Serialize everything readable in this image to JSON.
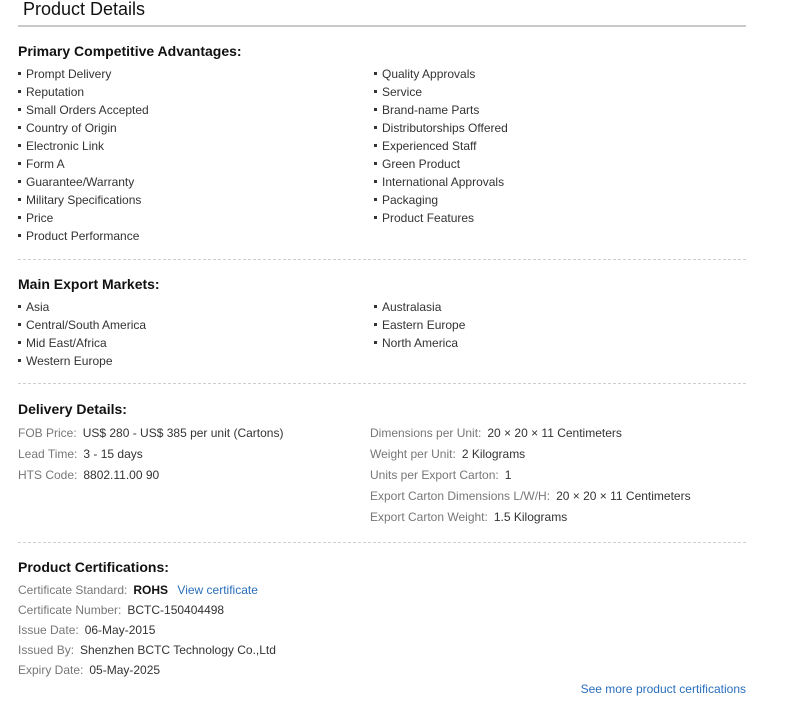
{
  "page": {
    "title": "Product Details"
  },
  "advantages": {
    "heading": "Primary Competitive Advantages:",
    "left": [
      "Prompt Delivery",
      "Reputation",
      "Small Orders Accepted",
      "Country of Origin",
      "Electronic Link",
      "Form A",
      "Guarantee/Warranty",
      "Military Specifications",
      "Price",
      "Product Performance"
    ],
    "right": [
      "Quality Approvals",
      "Service",
      "Brand-name Parts",
      "Distributorships Offered",
      "Experienced Staff",
      "Green Product",
      "International Approvals",
      "Packaging",
      "Product Features"
    ]
  },
  "markets": {
    "heading": "Main Export Markets:",
    "left": [
      "Asia",
      "Central/South America",
      "Mid East/Africa",
      "Western Europe"
    ],
    "right": [
      "Australasia",
      "Eastern Europe",
      "North America"
    ]
  },
  "delivery": {
    "heading": "Delivery Details:",
    "left": [
      {
        "label": "FOB Price:",
        "value": "US$ 280 - US$ 385 per unit (Cartons)"
      },
      {
        "label": "Lead Time:",
        "value": "3 - 15 days"
      },
      {
        "label": "HTS Code:",
        "value": "8802.11.00 90"
      }
    ],
    "right": [
      {
        "label": "Dimensions per Unit:",
        "value": "20 × 20 × 11 Centimeters"
      },
      {
        "label": "Weight per Unit:",
        "value": "2 Kilograms"
      },
      {
        "label": "Units per Export Carton:",
        "value": "1"
      },
      {
        "label": "Export Carton Dimensions L/W/H:",
        "value": "20 × 20 × 11 Centimeters"
      },
      {
        "label": "Export Carton Weight:",
        "value": "1.5 Kilograms"
      }
    ]
  },
  "certifications": {
    "heading": "Product Certifications:",
    "standard_label": "Certificate Standard:",
    "standard_value": "ROHS",
    "view_link": "View certificate",
    "number_label": "Certificate Number:",
    "number_value": "BCTC-150404498",
    "issue_label": "Issue Date:",
    "issue_value": "06-May-2015",
    "issuer_label": "Issued By:",
    "issuer_value": "Shenzhen BCTC Technology Co.,Ltd",
    "expiry_label": "Expiry Date:",
    "expiry_value": "05-May-2025",
    "see_more": "See more product certifications"
  }
}
